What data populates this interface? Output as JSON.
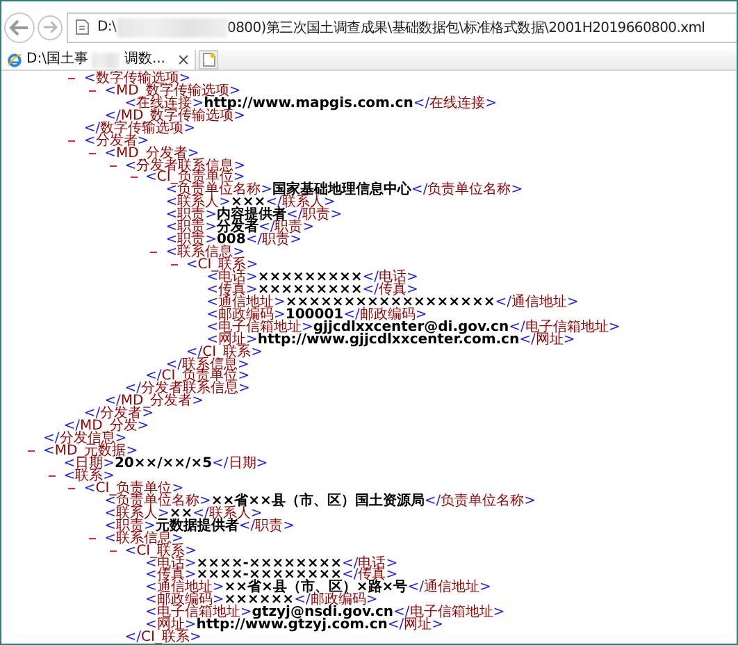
{
  "address_bar": {
    "prefix": "D:\\",
    "suffix": "0800)第三次国土调查成果\\基础数据包\\标准格式数据\\2001H2019660800.xml"
  },
  "tab": {
    "title_start": "D:\\国土事",
    "title_end": "调数...",
    "selected": true
  },
  "tree": [
    {
      "close_tag": "</分发信息>",
      "children": [
        {
          "close_tag": "</MD_分发>",
          "children": [
            {
              "open_tag": "<数字传输选项>",
              "expanded": true,
              "close_tag": "</数字传输选项>",
              "children": [
                {
                  "open_tag": "<MD_数字传输选项>",
                  "expanded": true,
                  "close_tag": "</MD_数字传输选项>",
                  "children": [
                    {
                      "open_tag": "<在线连接>",
                      "value": "http://www.mapgis.com.cn",
                      "close_tag": "</在线连接>"
                    }
                  ]
                }
              ]
            },
            {
              "open_tag": "<分发者>",
              "expanded": true,
              "close_tag": "</分发者>",
              "children": [
                {
                  "open_tag": "<MD_分发者>",
                  "expanded": true,
                  "close_tag": "</MD_分发者>",
                  "children": [
                    {
                      "open_tag": "<分发者联系信息>",
                      "expanded": true,
                      "close_tag": "</分发者联系信息>",
                      "children": [
                        {
                          "open_tag": "<CI_负责单位>",
                          "expanded": true,
                          "close_tag": "</CI_负责单位>",
                          "children": [
                            {
                              "open_tag": "<负责单位名称>",
                              "value": "国家基础地理信息中心",
                              "close_tag": "</负责单位名称>"
                            },
                            {
                              "open_tag": "<联系人>",
                              "value": "×××",
                              "close_tag": "</联系人>"
                            },
                            {
                              "open_tag": "<职责>",
                              "value": "内容提供者",
                              "close_tag": "</职责>"
                            },
                            {
                              "open_tag": "<职责>",
                              "value": "分发者",
                              "close_tag": "</职责>"
                            },
                            {
                              "open_tag": "<职责>",
                              "value": "008",
                              "close_tag": "</职责>"
                            },
                            {
                              "open_tag": "<联系信息>",
                              "expanded": true,
                              "close_tag": "</联系信息>",
                              "children": [
                                {
                                  "open_tag": "<CI_联系>",
                                  "expanded": true,
                                  "close_tag": "</CI_联系>",
                                  "children": [
                                    {
                                      "open_tag": "<电话>",
                                      "value": "×××××××××",
                                      "close_tag": "</电话>"
                                    },
                                    {
                                      "open_tag": "<传真>",
                                      "value": "×××××××××",
                                      "close_tag": "</传真>"
                                    },
                                    {
                                      "open_tag": "<通信地址>",
                                      "value": "××××××××××××××××××",
                                      "close_tag": "</通信地址>"
                                    },
                                    {
                                      "open_tag": "<邮政编码>",
                                      "value": "100001",
                                      "close_tag": "</邮政编码>"
                                    },
                                    {
                                      "open_tag": "<电子信箱地址>",
                                      "value": "gjjcdlxxcenter@di.gov.cn",
                                      "close_tag": "</电子信箱地址>"
                                    },
                                    {
                                      "open_tag": "<网址>",
                                      "value": "http://www.gjjcdlxxcenter.com.cn",
                                      "close_tag": "</网址>"
                                    }
                                  ]
                                }
                              ]
                            }
                          ]
                        }
                      ]
                    }
                  ]
                }
              ]
            }
          ]
        }
      ]
    },
    {
      "open_tag": "<MD_元数据>",
      "expanded": true,
      "children": [
        {
          "open_tag": "<日期>",
          "value": "20××/××/×5",
          "close_tag": "</日期>"
        },
        {
          "open_tag": "<联系>",
          "expanded": true,
          "children": [
            {
              "open_tag": "<CI_负责单位>",
              "expanded": true,
              "children": [
                {
                  "open_tag": "<负责单位名称>",
                  "value": "××省××县（市、区）国土资源局",
                  "close_tag": "</负责单位名称>"
                },
                {
                  "open_tag": "<联系人>",
                  "value": "××",
                  "close_tag": "</联系人>"
                },
                {
                  "open_tag": "<职责>",
                  "value": "元数据提供者",
                  "close_tag": "</职责>"
                },
                {
                  "open_tag": "<联系信息>",
                  "expanded": true,
                  "children": [
                    {
                      "open_tag": "<CI_联系>",
                      "expanded": true,
                      "close_tag": "</CI_联系>",
                      "children": [
                        {
                          "open_tag": "<电话>",
                          "value": "××××-××××××××",
                          "close_tag": "</电话>"
                        },
                        {
                          "open_tag": "<传真>",
                          "value": "××××-××××××××",
                          "close_tag": "</传真>"
                        },
                        {
                          "open_tag": "<通信地址>",
                          "value": "××省×县（市、区）×路×号",
                          "close_tag": "</通信地址>"
                        },
                        {
                          "open_tag": "<邮政编码>",
                          "value": "××××××",
                          "close_tag": "</邮政编码>"
                        },
                        {
                          "open_tag": "<电子信箱地址>",
                          "value": "gtzyj@nsdi.gov.cn",
                          "close_tag": "</电子信箱地址>"
                        },
                        {
                          "open_tag": "<网址>",
                          "value": "http://www.gtzyj.com.cn",
                          "close_tag": "</网址>"
                        }
                      ]
                    }
                  ]
                }
              ]
            }
          ]
        }
      ]
    }
  ]
}
